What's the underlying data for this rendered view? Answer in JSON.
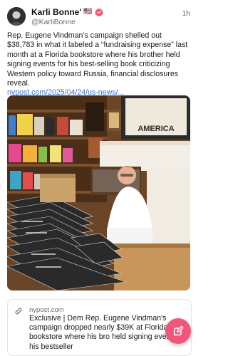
{
  "post": {
    "author_name": "Karli Bonne'",
    "author_flag": "🇺🇸",
    "author_handle": "@KarliBonne",
    "time": "1h",
    "body": "Rep. Eugene Vindman’s campaign shelled out $38,783 in what it labeled a “fundraising expense” last month at a Florida bookstore where his brother held signing events for his best-selling book criticizing Western policy toward Russia, financial disclosures reveal.",
    "link_text": "nypost.com/2025/04/24/us-news/...",
    "image_sign_text": "AMERICA"
  },
  "link_card": {
    "domain": "nypost.com",
    "title": "Exclusive | Dem Rep. Eugene Vindman's campaign dropped nearly $39K at Florida bookstore where his bro held signing events for his bestseller"
  },
  "colors": {
    "link": "#3b6fd6",
    "verified": "#f2557a",
    "fab": "#f2557a"
  },
  "icons": {
    "verified": "verified-badge-icon",
    "link": "link-icon",
    "compose": "compose-icon"
  }
}
